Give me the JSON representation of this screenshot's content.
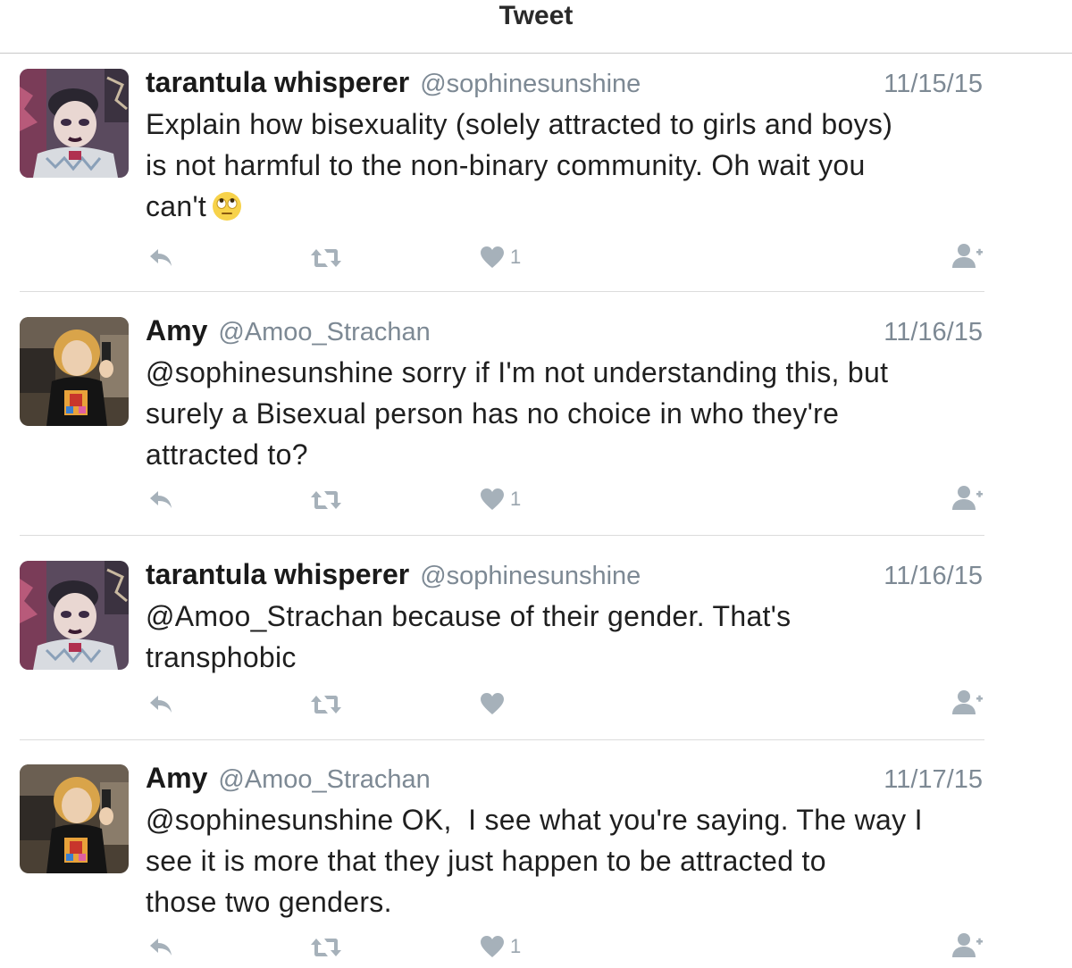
{
  "header": {
    "title": "Tweet"
  },
  "colors": {
    "icon_gray": "#a6b1ba",
    "text_gray": "#7d8994",
    "divider": "#dcdcdc"
  },
  "icons": {
    "reply": "reply-icon",
    "retweet": "retweet-icon",
    "like": "heart-icon",
    "follow": "follow-user-icon",
    "emoji": "face-with-rolling-eyes-emoji"
  },
  "tweets": [
    {
      "display_name": "tarantula whisperer",
      "handle": "@sophinesunshine",
      "date": "11/15/15",
      "text": "Explain how bisexuality (solely attracted to girls and boys)\nis not harmful to the non-binary community. Oh wait you\ncan't",
      "likes": "1"
    },
    {
      "display_name": "Amy",
      "handle": "@Amoo_Strachan",
      "date": "11/16/15",
      "text": "@sophinesunshine sorry if I'm not understanding this, but\nsurely a Bisexual person has no choice in who they're\nattracted to?",
      "likes": "1"
    },
    {
      "display_name": "tarantula whisperer",
      "handle": "@sophinesunshine",
      "date": "11/16/15",
      "text": "@Amoo_Strachan because of their gender. That's\ntransphobic",
      "likes": ""
    },
    {
      "display_name": "Amy",
      "handle": "@Amoo_Strachan",
      "date": "11/17/15",
      "text": "@sophinesunshine OK,  I see what you're saying. The way I\nsee it is more that they just happen to be attracted to\nthose two genders.",
      "likes": "1"
    }
  ]
}
